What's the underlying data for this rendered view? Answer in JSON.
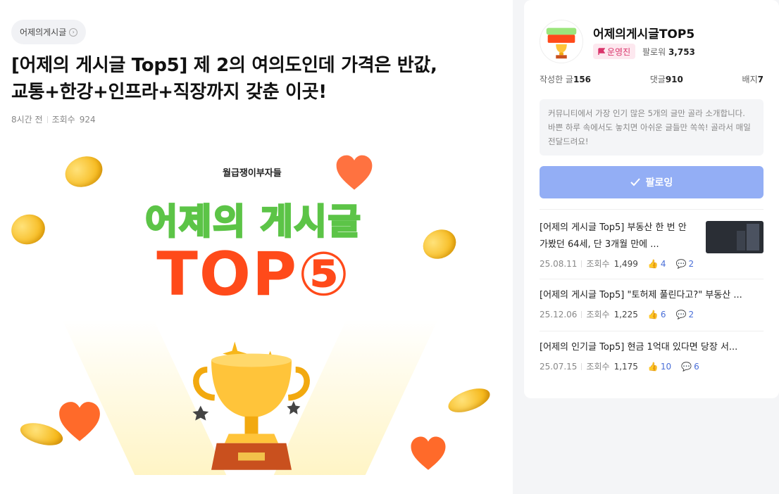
{
  "category": {
    "label": "어제의게시글"
  },
  "post": {
    "title_line1": "[어제의 게시글 Top5] 제 2의 여의도인데 가격은 반값,",
    "title_line2": "교통+한강+인프라+직장까지 갖춘 이곳!",
    "time": "8시간 전",
    "views_label": "조회수",
    "views": "924"
  },
  "hero": {
    "brand": "월급쟁이부자들",
    "headline1": "어제의 게시글",
    "headline2": "TOP⑤"
  },
  "sidebar": {
    "name": "어제의게시글TOP5",
    "operator_badge": "운영진",
    "followers_label": "팔로워",
    "followers": "3,753",
    "stats": {
      "posts_label": "작성한 글",
      "posts": "156",
      "comments_label": "댓글",
      "comments": "910",
      "badges_label": "배지",
      "badges": "7"
    },
    "description": "커뮤니티에서 가장 인기 많은 5개의 글만 골라 소개합니다. 바쁜 하루 속에서도 놓치면 아쉬운 글들만 쏙쏙! 골라서 매일 전달드려요!",
    "follow_button": "팔로잉",
    "posts": [
      {
        "title": "[어제의 게시글 Top5] 부동산 한 번 안 가봤던 64세, 단 3개월 만에 ...",
        "date": "25.08.11",
        "views_label": "조회수",
        "views": "1,499",
        "likes": "4",
        "comments": "2"
      },
      {
        "title": "[어제의 게시글 Top5] \"토허제 풀린다고?\" 부동산 ...",
        "date": "25.12.06",
        "views_label": "조회수",
        "views": "1,225",
        "likes": "6",
        "comments": "2"
      },
      {
        "title": "[어제의 인기글 Top5] 현금 1억대 있다면 당장 서...",
        "date": "25.07.15",
        "views_label": "조회수",
        "views": "1,175",
        "likes": "10",
        "comments": "6"
      }
    ]
  }
}
